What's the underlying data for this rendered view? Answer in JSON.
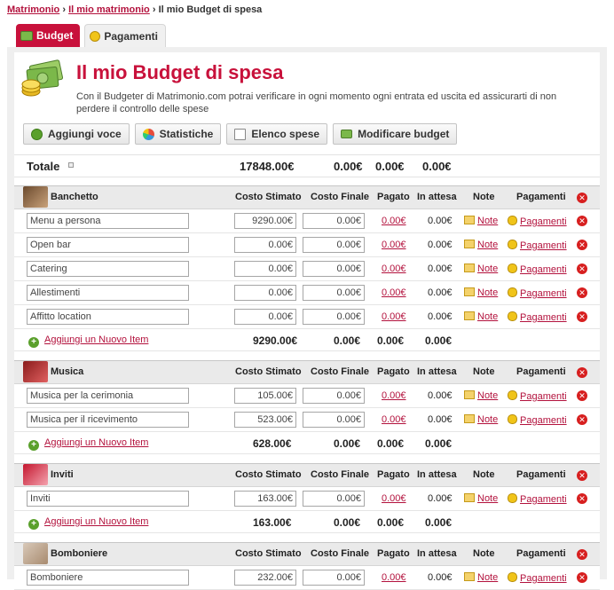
{
  "breadcrumb": {
    "link1": "Matrimonio",
    "link2": "Il mio matrimonio",
    "current": "Il mio Budget di spesa",
    "sep": "›"
  },
  "tabs": [
    {
      "label": "Budget"
    },
    {
      "label": "Pagamenti"
    }
  ],
  "header": {
    "title": "Il mio Budget di spesa",
    "description": "Con il Budgeter di Matrimonio.com potrai verificare in ogni momento ogni entrata ed uscita ed assicurarti di non perdere il controllo delle spese"
  },
  "toolbar": {
    "add": "Aggiungi voce",
    "stats": "Statistiche",
    "list": "Elenco spese",
    "modify": "Modificare budget"
  },
  "totals": {
    "label": "Totale",
    "estimated": "17848.00€",
    "final": "0.00€",
    "paid": "0.00€",
    "pending": "0.00€"
  },
  "columns": {
    "estimated": "Costo Stimato",
    "final": "Costo Finale",
    "paid": "Pagato",
    "pending": "In attesa",
    "note": "Note",
    "payments": "Pagamenti"
  },
  "common": {
    "note_link": "Note",
    "pay_link": "Pagamenti",
    "add_item": "Aggiungi un Nuovo Item"
  },
  "sections": [
    {
      "name": "Banchetto",
      "items": [
        {
          "name": "Menu a persona",
          "est": "9290.00€",
          "fin": "0.00€",
          "paid": "0.00€",
          "pend": "0.00€"
        },
        {
          "name": "Open bar",
          "est": "0.00€",
          "fin": "0.00€",
          "paid": "0.00€",
          "pend": "0.00€"
        },
        {
          "name": "Catering",
          "est": "0.00€",
          "fin": "0.00€",
          "paid": "0.00€",
          "pend": "0.00€"
        },
        {
          "name": "Allestimenti",
          "est": "0.00€",
          "fin": "0.00€",
          "paid": "0.00€",
          "pend": "0.00€"
        },
        {
          "name": "Affitto location",
          "est": "0.00€",
          "fin": "0.00€",
          "paid": "0.00€",
          "pend": "0.00€"
        }
      ],
      "sum": {
        "est": "9290.00€",
        "fin": "0.00€",
        "paid": "0.00€",
        "pend": "0.00€"
      }
    },
    {
      "name": "Musica",
      "items": [
        {
          "name": "Musica per la cerimonia",
          "est": "105.00€",
          "fin": "0.00€",
          "paid": "0.00€",
          "pend": "0.00€"
        },
        {
          "name": "Musica per il ricevimento",
          "est": "523.00€",
          "fin": "0.00€",
          "paid": "0.00€",
          "pend": "0.00€"
        }
      ],
      "sum": {
        "est": "628.00€",
        "fin": "0.00€",
        "paid": "0.00€",
        "pend": "0.00€"
      }
    },
    {
      "name": "Inviti",
      "items": [
        {
          "name": "Inviti",
          "est": "163.00€",
          "fin": "0.00€",
          "paid": "0.00€",
          "pend": "0.00€"
        }
      ],
      "sum": {
        "est": "163.00€",
        "fin": "0.00€",
        "paid": "0.00€",
        "pend": "0.00€"
      }
    },
    {
      "name": "Bomboniere",
      "items": [
        {
          "name": "Bomboniere",
          "est": "232.00€",
          "fin": "0.00€",
          "paid": "0.00€",
          "pend": "0.00€"
        }
      ]
    }
  ],
  "colors": {
    "accent": "#c8113b",
    "link": "#b3123d",
    "delete": "#d71f1f",
    "add": "#5aa02c"
  }
}
